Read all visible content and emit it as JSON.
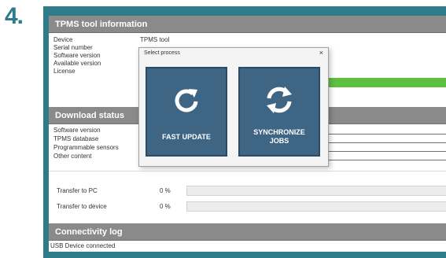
{
  "step_number": "4.",
  "colors": {
    "frame": "#2e7b8a",
    "header": "#8a8a8a",
    "tile": "#3f6585",
    "status_green": "#5fbf3f"
  },
  "tool_info": {
    "header": "TPMS tool information",
    "rows": [
      {
        "label": "Device",
        "value": "TPMS tool"
      },
      {
        "label": "Serial number",
        "value": ""
      },
      {
        "label": "Software version",
        "value": ""
      },
      {
        "label": "Available version",
        "value": ""
      },
      {
        "label": "License",
        "value": ""
      }
    ]
  },
  "download_status": {
    "header": "Download status",
    "rows": [
      "Software version",
      "TPMS database",
      "Programmable sensors",
      "Other content"
    ]
  },
  "transfer": {
    "to_pc": {
      "label": "Transfer to PC",
      "percent": "0 %",
      "progress": 0
    },
    "to_device": {
      "label": "Transfer to device",
      "percent": "0 %",
      "progress": 0
    }
  },
  "connectivity": {
    "header": "Connectivity log",
    "log": "USB Device connected"
  },
  "dialog": {
    "title": "Select process",
    "close": "×",
    "buttons": [
      {
        "label": "FAST UPDATE",
        "icon": "refresh-icon"
      },
      {
        "label_line1": "SYNCHRONIZE",
        "label_line2": "JOBS",
        "icon": "sync-icon"
      }
    ]
  }
}
